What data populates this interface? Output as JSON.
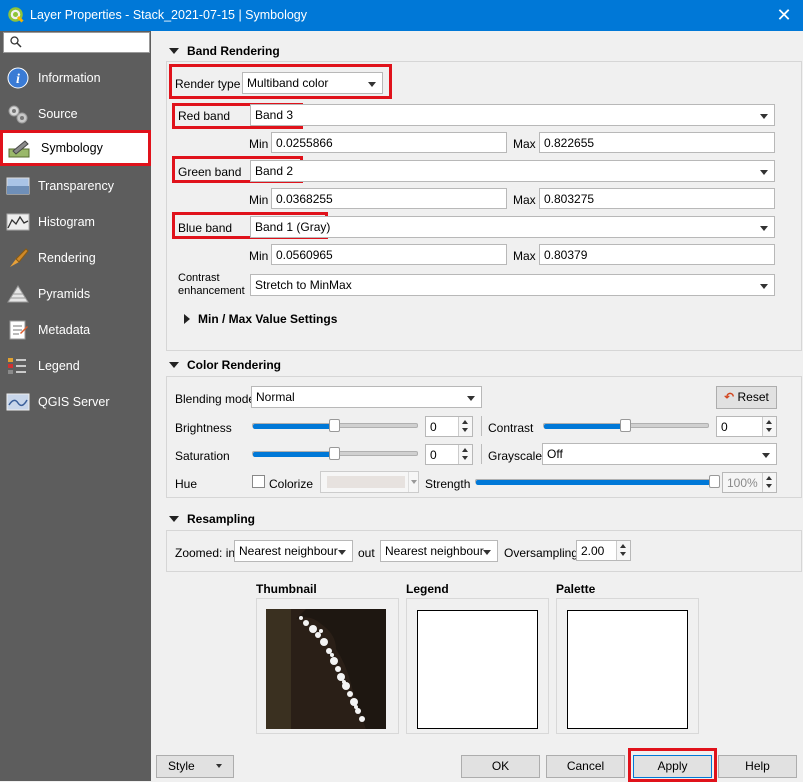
{
  "window": {
    "title": "Layer Properties - Stack_2021-07-15 | Symbology",
    "close": "✕"
  },
  "sidebar": {
    "search_placeholder": "",
    "items": [
      {
        "label": "Information"
      },
      {
        "label": "Source"
      },
      {
        "label": "Symbology"
      },
      {
        "label": "Transparency"
      },
      {
        "label": "Histogram"
      },
      {
        "label": "Rendering"
      },
      {
        "label": "Pyramids"
      },
      {
        "label": "Metadata"
      },
      {
        "label": "Legend"
      },
      {
        "label": "QGIS Server"
      }
    ],
    "active": "Symbology"
  },
  "band_rendering": {
    "title": "Band Rendering",
    "render_type_label": "Render type",
    "render_type_value": "Multiband color",
    "red": {
      "label": "Red band",
      "value": "Band 3",
      "min": "0.0255866",
      "max": "0.822655"
    },
    "green": {
      "label": "Green band",
      "value": "Band 2",
      "min": "0.0368255",
      "max": "0.803275"
    },
    "blue": {
      "label": "Blue band",
      "value": "Band 1 (Gray)",
      "min": "0.0560965",
      "max": "0.80379"
    },
    "min_label": "Min",
    "max_label": "Max",
    "contrast_label_1": "Contrast",
    "contrast_label_2": "enhancement",
    "contrast_value": "Stretch to MinMax",
    "minmax_settings": "Min / Max Value Settings"
  },
  "color_rendering": {
    "title": "Color Rendering",
    "blending_label": "Blending mode",
    "blending_value": "Normal",
    "reset": "Reset",
    "brightness_label": "Brightness",
    "brightness_value": "0",
    "brightness_level": 0.5,
    "contrast_label": "Contrast",
    "contrast_value": "0",
    "contrast_level": 0.5,
    "saturation_label": "Saturation",
    "saturation_value": "0",
    "saturation_level": 0.5,
    "grayscale_label": "Grayscale",
    "grayscale_value": "Off",
    "hue_label": "Hue",
    "colorize_label": "Colorize",
    "strength_label": "Strength",
    "strength_value": "100%",
    "strength_level": 1.0
  },
  "resampling": {
    "title": "Resampling",
    "zoomed_in_label": "Zoomed: in",
    "zoomed_in_value": "Nearest neighbour",
    "out_label": "out",
    "zoomed_out_value": "Nearest neighbour",
    "oversampling_label": "Oversampling",
    "oversampling_value": "2.00"
  },
  "previews": {
    "thumbnail": "Thumbnail",
    "legend": "Legend",
    "palette": "Palette"
  },
  "footer": {
    "style": "Style",
    "ok": "OK",
    "cancel": "Cancel",
    "apply": "Apply",
    "help": "Help"
  },
  "colors": {
    "titlebar": "#0078d7",
    "sidebar": "#5d5d5d",
    "highlight": "#e0121b",
    "slider": "#0078d7"
  }
}
